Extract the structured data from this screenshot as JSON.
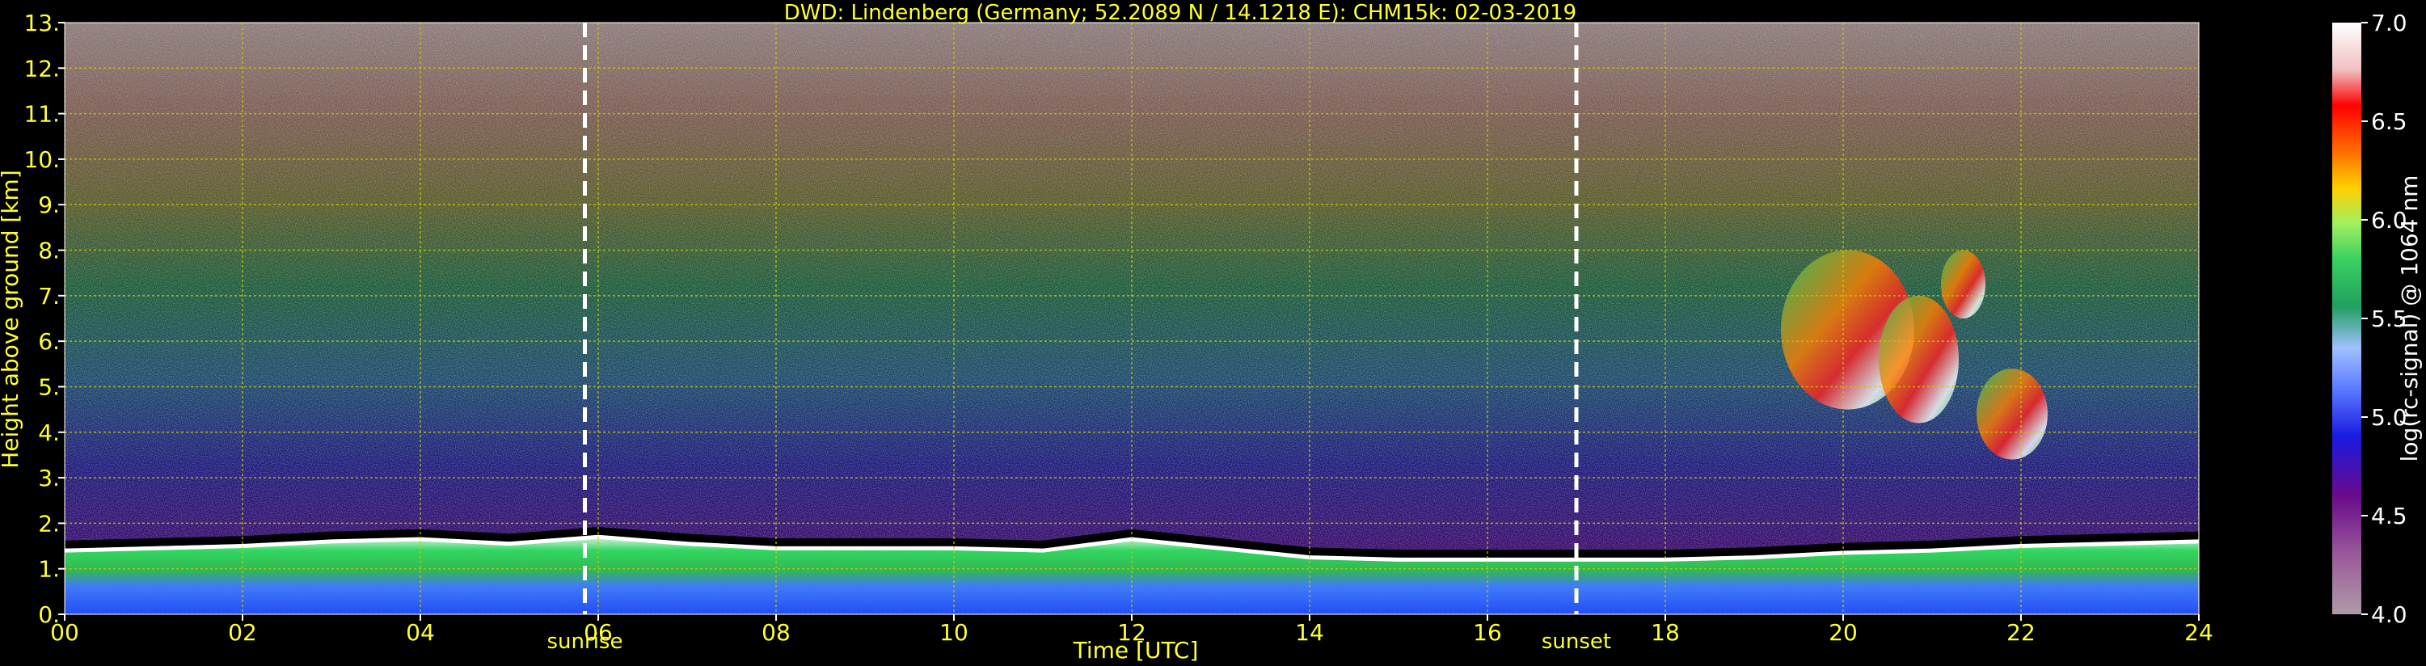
{
  "chart_data": {
    "type": "heatmap",
    "title": "DWD: Lindenberg (Germany; 52.2089 N / 14.1218 E):    CHM15k: 02-03-2019",
    "xlabel": "Time [UTC]",
    "ylabel": "Height above ground [km]",
    "xlim": [
      0,
      24
    ],
    "ylim": [
      0,
      13
    ],
    "x_ticks": [
      "00",
      "02",
      "04",
      "06",
      "08",
      "10",
      "12",
      "14",
      "16",
      "18",
      "20",
      "22",
      "24"
    ],
    "y_ticks": [
      "0.",
      "1.",
      "2.",
      "3.",
      "4.",
      "5.",
      "6.",
      "7.",
      "8.",
      "9.",
      "10.",
      "11.",
      "12.",
      "13."
    ],
    "grid": true,
    "events": [
      {
        "label": "sunrise",
        "time": 5.85
      },
      {
        "label": "sunset",
        "time": 17.0
      }
    ],
    "colorbar": {
      "label": "log(rc-signal) @ 1064 nm",
      "range": [
        4.0,
        7.0
      ],
      "ticks": [
        "4.0",
        "4.5",
        "5.0",
        "5.5",
        "6.0",
        "6.5",
        "7.0"
      ]
    },
    "boundary_layer_top_km": [
      [
        0,
        1.45
      ],
      [
        1,
        1.5
      ],
      [
        2,
        1.55
      ],
      [
        3,
        1.65
      ],
      [
        4,
        1.7
      ],
      [
        5,
        1.6
      ],
      [
        6,
        1.75
      ],
      [
        7,
        1.6
      ],
      [
        8,
        1.5
      ],
      [
        9,
        1.5
      ],
      [
        10,
        1.5
      ],
      [
        11,
        1.45
      ],
      [
        12,
        1.7
      ],
      [
        13,
        1.5
      ],
      [
        14,
        1.3
      ],
      [
        15,
        1.25
      ],
      [
        16,
        1.25
      ],
      [
        17,
        1.25
      ],
      [
        18,
        1.25
      ],
      [
        19,
        1.3
      ],
      [
        20,
        1.4
      ],
      [
        21,
        1.45
      ],
      [
        22,
        1.55
      ],
      [
        23,
        1.6
      ],
      [
        24,
        1.65
      ]
    ],
    "cloud_layers": [
      {
        "t_start": 19.3,
        "t_end": 20.8,
        "h_low": 4.5,
        "h_high": 8.0
      },
      {
        "t_start": 20.4,
        "t_end": 21.3,
        "h_low": 4.2,
        "h_high": 7.0
      },
      {
        "t_start": 21.1,
        "t_end": 21.6,
        "h_low": 6.5,
        "h_high": 8.0
      },
      {
        "t_start": 21.5,
        "t_end": 22.3,
        "h_low": 3.4,
        "h_high": 5.4
      }
    ]
  }
}
